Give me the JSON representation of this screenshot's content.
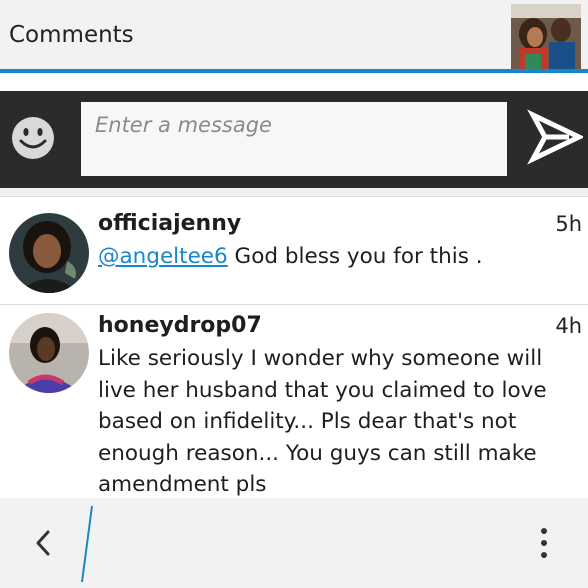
{
  "header": {
    "title": "Comments"
  },
  "composer": {
    "placeholder": "Enter a message"
  },
  "comments": [
    {
      "username": "officiajenny",
      "time": "5h",
      "mention": "@angeltee6",
      "text": " God bless you for this ."
    },
    {
      "username": "honeydrop07",
      "time": "4h",
      "text": "Like seriously I wonder why someone will live her husband that you claimed to love based on infidelity... Pls dear that's not enough reason... You guys can still make amendment pls"
    }
  ],
  "icons": {
    "emoji": "smiley-icon",
    "send": "send-icon",
    "back": "chevron-left-icon",
    "menu": "more-vertical-icon"
  },
  "colors": {
    "accent": "#1a87c8",
    "composer_bg": "#2b2b2b",
    "header_bg": "#f2f2f2"
  }
}
